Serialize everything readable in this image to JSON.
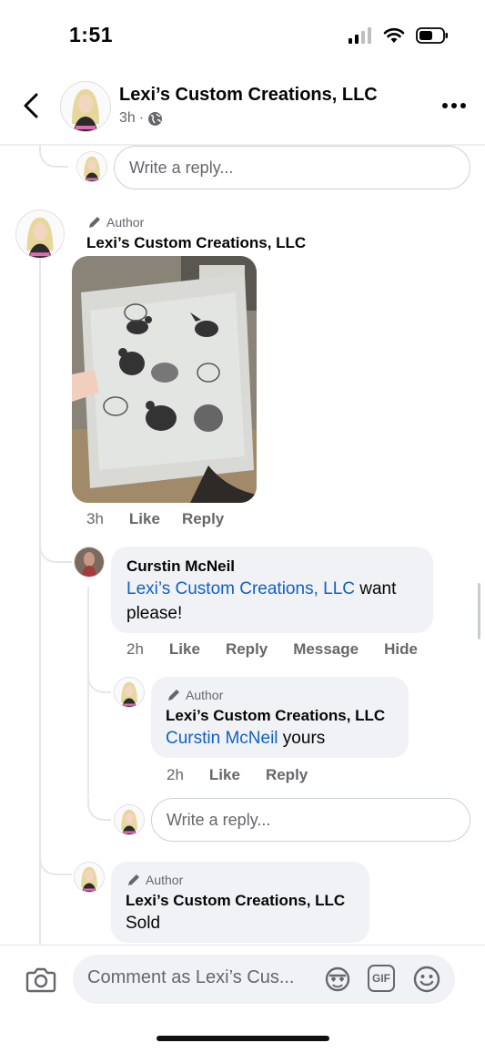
{
  "status_bar": {
    "time": "1:51"
  },
  "header": {
    "title": "Lexi’s Custom Creations, LLC",
    "time": "3h",
    "privacy_icon": "globe-icon"
  },
  "top_reply": {
    "placeholder": "Write a reply..."
  },
  "comment_main": {
    "tag": "Author",
    "name": "Lexi’s Custom Creations, LLC",
    "time": "3h",
    "like": "Like",
    "reply": "Reply"
  },
  "comment_curstin": {
    "name": "Curstin McNeil",
    "mention": "Lexi’s Custom Creations, LLC",
    "text_after_mention": " want",
    "text_line2": "please!",
    "time": "2h",
    "like": "Like",
    "reply": "Reply",
    "message": "Message",
    "hide": "Hide"
  },
  "comment_reply_lexi": {
    "tag": "Author",
    "name": "Lexi’s Custom Creations, LLC",
    "mention": "Curstin McNeil",
    "text_after_mention": " yours",
    "time": "2h",
    "like": "Like",
    "reply": "Reply"
  },
  "nested_reply": {
    "placeholder": "Write a reply..."
  },
  "comment_sold": {
    "tag": "Author",
    "name": "Lexi’s Custom Creations, LLC",
    "text": "Sold"
  },
  "composer": {
    "placeholder": "Comment as Lexi’s Cus...",
    "gif_label": "GIF"
  },
  "colors": {
    "mention": "#1160c9",
    "bubble": "#f0f2f5",
    "secondary_text": "#65676b"
  }
}
